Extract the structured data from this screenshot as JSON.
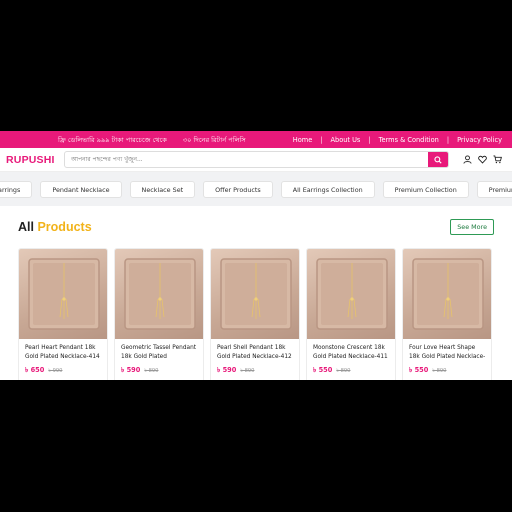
{
  "topbar": {
    "promo": [
      "ফ্রি ডেলিভারি ৯৯৯ টাকা পারচেজে থেকে",
      "৩০ দিনের রিটার্ন পলিসি"
    ],
    "links": [
      "Home",
      "About Us",
      "Terms & Condition",
      "Privacy Policy"
    ]
  },
  "header": {
    "logo": "RUPUSHI",
    "search_placeholder": "আপনার পছন্দের পণ্য খুঁজুন...",
    "icons": [
      "search-icon",
      "user-icon",
      "heart-icon",
      "cart-icon"
    ]
  },
  "categories": [
    "Earrings",
    "Pendant Necklace",
    "Necklace Set",
    "Offer Products",
    "All Earrings Collection",
    "Premium Collection",
    "Premium Earrings"
  ],
  "section": {
    "title_main": "All",
    "title_accent": "Products",
    "see_more": "See More"
  },
  "products": [
    {
      "name": "Pearl Heart Pendant 18k Gold Plated Necklace-414",
      "price": "৳ 650",
      "old_price": "৳ 990"
    },
    {
      "name": "Geometric Tassel Pendant 18k Gold Plated Necklace-...",
      "price": "৳ 590",
      "old_price": "৳ 890"
    },
    {
      "name": "Pearl Shell Pendant 18k Gold Plated Necklace-412",
      "price": "৳ 590",
      "old_price": "৳ 890"
    },
    {
      "name": "Moonstone Crescent 18k Gold Plated Necklace-411",
      "price": "৳ 550",
      "old_price": "৳ 890"
    },
    {
      "name": "Four Love Heart Shape 18k Gold Plated Necklace-410",
      "price": "৳ 550",
      "old_price": "৳ 890"
    }
  ],
  "colors": {
    "brand": "#e8197a",
    "accent": "#f2b31a",
    "see_more_border": "#2e9a55"
  }
}
